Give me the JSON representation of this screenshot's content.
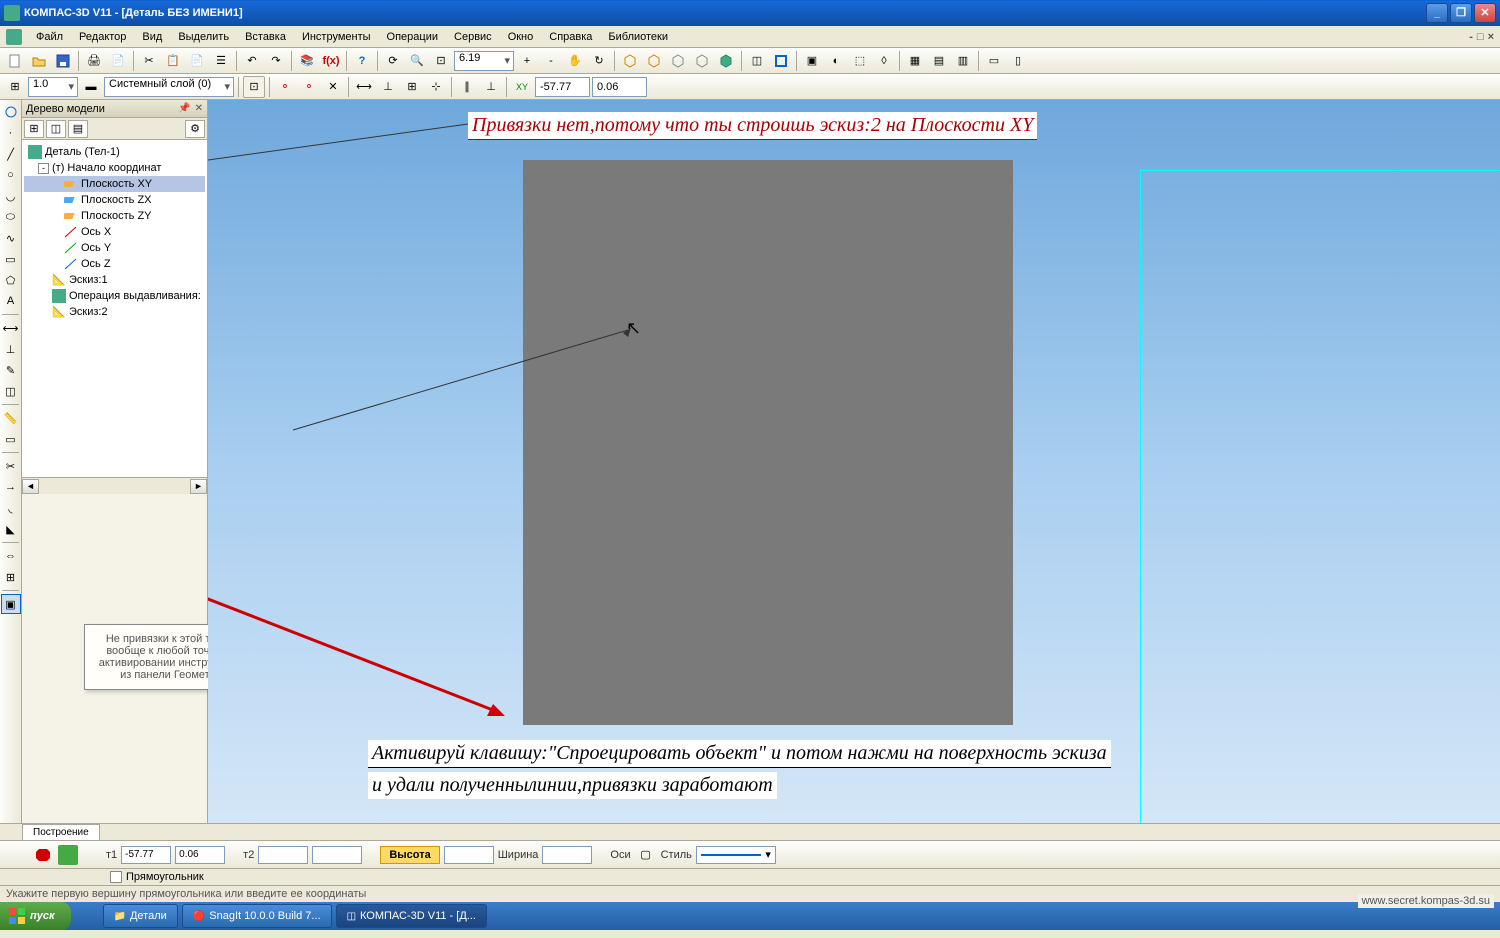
{
  "title": "КОМПАС-3D V11 - [Деталь БЕЗ ИМЕНИ1]",
  "menu": [
    "Файл",
    "Редактор",
    "Вид",
    "Выделить",
    "Вставка",
    "Инструменты",
    "Операции",
    "Сервис",
    "Окно",
    "Справка",
    "Библиотеки"
  ],
  "toolbar2": {
    "scale": "1.0",
    "layer": "Системный слой (0)",
    "coord1": "6.19",
    "coord2": "-57.77",
    "coord3": "0.06"
  },
  "tree": {
    "title": "Дерево модели",
    "root": "Деталь (Тел-1)",
    "origin": "(т) Начало координат",
    "items": [
      "Плоскость XY",
      "Плоскость ZX",
      "Плоскость ZY",
      "Ось X",
      "Ось Y",
      "Ось Z"
    ],
    "sketch1": "Эскиз:1",
    "extrude": "Операция выдавливания:",
    "sketch2": "Эскиз:2"
  },
  "annotations": {
    "top": "Привязки нет,потому что ты строишь эскиз:2 на Плоскости XY",
    "callout": "Не привязки к этой точке и вообще к любой точке при активировании инструментов из панели Геометрия",
    "bottom1": "Активируй клавишу:\"Спроецировать объект\" и потом нажми на поверхность эскиза",
    "bottom2": "и удали полученнылинии,привязки заработают"
  },
  "bottom_tab1": "Построение",
  "bottom_toolbar": {
    "t1": "т1",
    "v1": "-57.77",
    "v2": "0.06",
    "t2": "т2",
    "height_label": "Высота",
    "width_label": "Ширина",
    "ang_label": "Оси",
    "style_label": "Стиль"
  },
  "bottom_tab2_label": "Прямоугольник",
  "status": "Укажите первую вершину прямоугольника или введите ее координаты",
  "taskbar": {
    "start": "пуск",
    "items": [
      "Детали",
      "SnagIt 10.0.0 Build 7...",
      "КОМПАС-3D V11 - [Д..."
    ]
  },
  "watermark": "www.secret.kompas-3d.su"
}
